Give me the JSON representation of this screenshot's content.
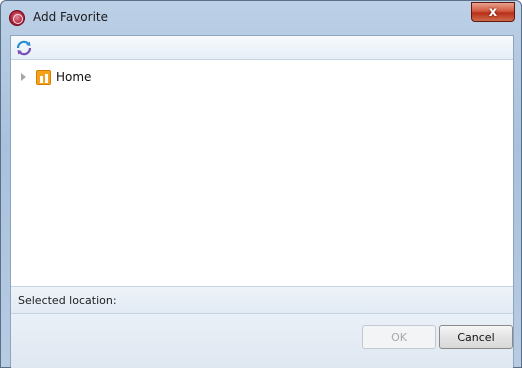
{
  "window": {
    "title": "Add Favorite",
    "close_symbol": "x"
  },
  "toolbar": {
    "refresh_icon": "refresh-icon"
  },
  "tree": {
    "nodes": [
      {
        "label": "Home",
        "icon": "home-folder-icon",
        "expanded": false
      }
    ]
  },
  "status": {
    "label": "Selected location:"
  },
  "footer": {
    "ok_label": "OK",
    "ok_enabled": false,
    "cancel_label": "Cancel"
  },
  "colors": {
    "accent": "#2b8fd6",
    "close_button": "#c8432a",
    "folder_icon": "#f4a21c"
  }
}
